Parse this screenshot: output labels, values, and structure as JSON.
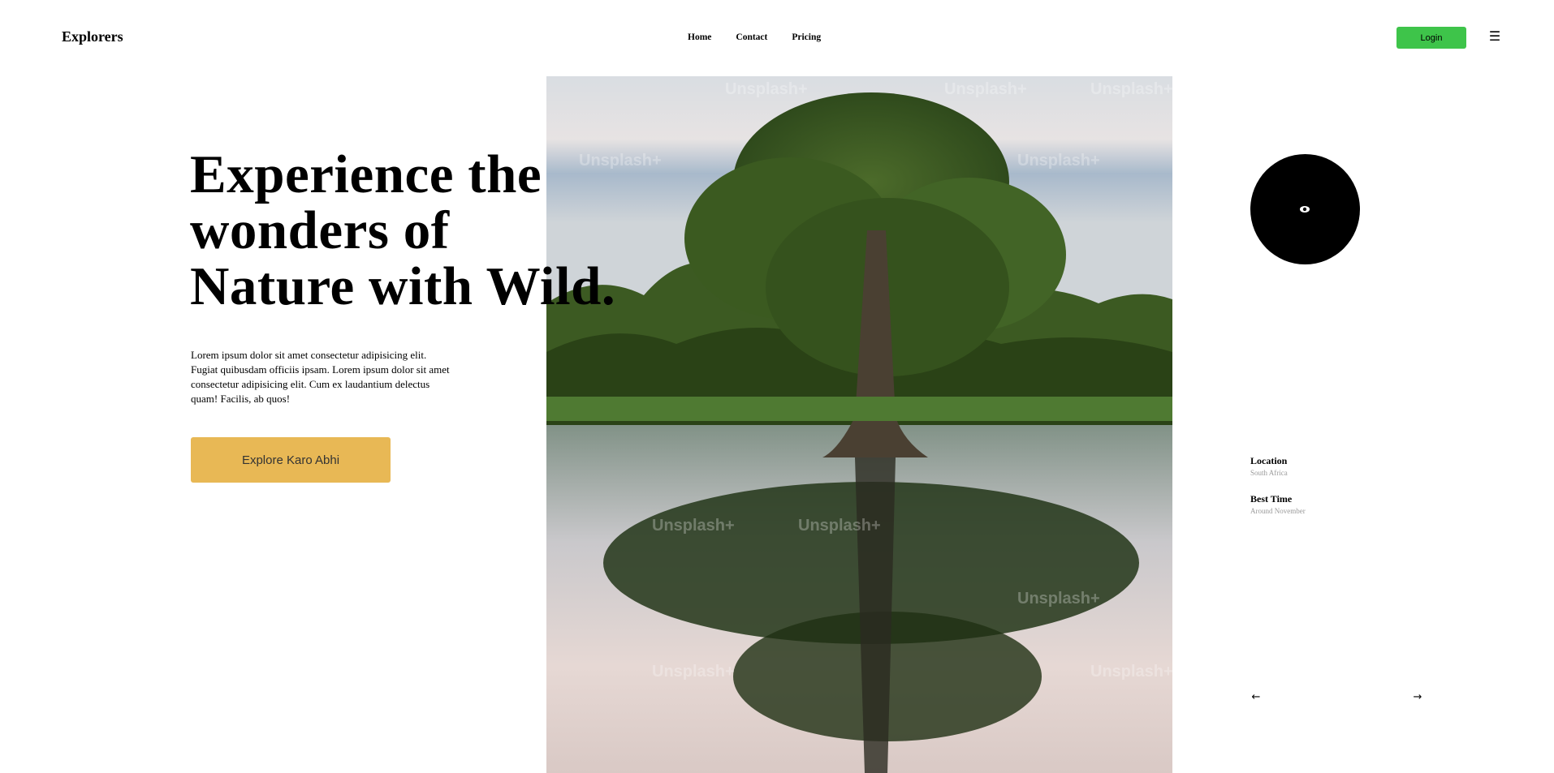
{
  "brand": "Explorers",
  "nav": {
    "items": [
      "Home",
      "Contact",
      "Pricing"
    ],
    "login_label": "Login",
    "menu_icon": "hamburger-icon"
  },
  "hero": {
    "headline": [
      "Experience the",
      "wonders of",
      "Nature with Wild."
    ],
    "paragraph": "Lorem ipsum dolor sit amet consectetur adipisicing elit. Fugiat quibusdam officiis ipsam. Lorem ipsum dolor sit amet consectetur adipisicing elit. Cum ex laudantium delectus quam! Facilis, ab quos!",
    "cta_label": "Explore Karo Abhi",
    "image_watermark": "Unsplash+"
  },
  "details": {
    "location_label": "Location",
    "location_value": "South Africa",
    "best_time_label": "Best Time",
    "best_time_value": "Around November"
  },
  "icons": {
    "prev": "arrow-left-icon",
    "next": "arrow-right-icon",
    "eye": "eye-icon"
  },
  "colors": {
    "login": "#3ec44a",
    "cta": "#e8b855",
    "disc": "#000000"
  }
}
